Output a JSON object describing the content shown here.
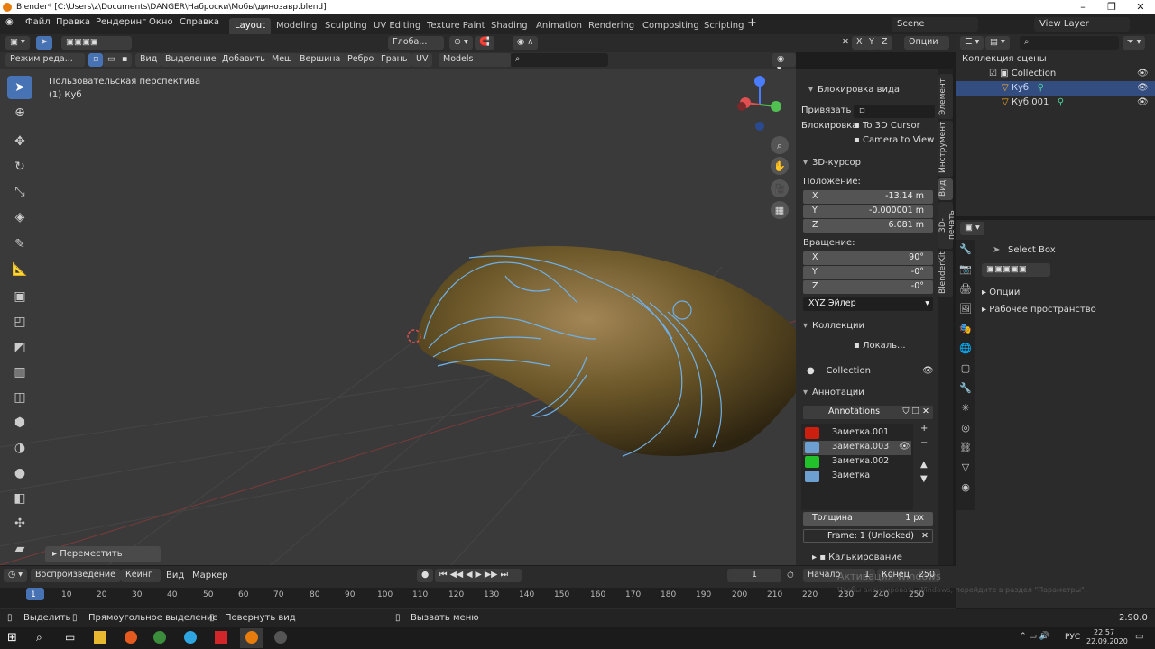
{
  "window": {
    "title": "Blender* [C:\\Users\\z\\Documents\\DANGER\\Наброски\\Мобы\\динозавр.blend]"
  },
  "menu": [
    "Файл",
    "Правка",
    "Рендеринг",
    "Окно",
    "Справка"
  ],
  "workspaces": [
    "Layout",
    "Modeling",
    "Sculpting",
    "UV Editing",
    "Texture Paint",
    "Shading",
    "Animation",
    "Rendering",
    "Compositing",
    "Scripting"
  ],
  "active_workspace": "Layout",
  "scene": "Scene",
  "view_layer": "View Layer",
  "header": {
    "transform": "Глоба...",
    "axes": [
      "X",
      "Y",
      "Z"
    ],
    "options": "Опции"
  },
  "viewport_header": {
    "mode": "Режим реда...",
    "menus": [
      "Вид",
      "Выделение",
      "Добавить",
      "Меш",
      "Вершина",
      "Ребро",
      "Грань",
      "UV"
    ],
    "models": "Models"
  },
  "viewport": {
    "perspective": "Пользовательская перспектива",
    "object": "(1) Куб",
    "operator": "Переместить"
  },
  "npanel": {
    "view_lock": "Блокировка вида",
    "bind_label": "Привязать ...",
    "lock_label": "Блокировка",
    "to_3d_cursor": "To 3D Cursor",
    "camera_to_view": "Camera to View",
    "cursor_title": "3D-курсор",
    "location": "Положение:",
    "loc": [
      {
        "k": "X",
        "v": "-13.14 m"
      },
      {
        "k": "Y",
        "v": "-0.000001 m"
      },
      {
        "k": "Z",
        "v": "6.081 m"
      }
    ],
    "rotation": "Вращение:",
    "rot": [
      {
        "k": "X",
        "v": "90°"
      },
      {
        "k": "Y",
        "v": "-0°"
      },
      {
        "k": "Z",
        "v": "-0°"
      }
    ],
    "rot_mode": "XYZ Эйлер",
    "collections_title": "Коллекции",
    "local": "Локаль...",
    "collection": "Collection",
    "annotations_title": "Аннотации",
    "annotations_name": "Annotations",
    "layers": [
      {
        "name": "Заметка.001",
        "color": "#cc1f0f"
      },
      {
        "name": "Заметка.003",
        "color": "#6da0d0"
      },
      {
        "name": "Заметка.002",
        "color": "#22c02a"
      },
      {
        "name": "Заметка",
        "color": "#6da0d0"
      }
    ],
    "thickness_label": "Толщина",
    "thickness": "1 px",
    "frame": "Frame: 1 (Unlocked)",
    "onion": "Калькирование"
  },
  "sidetabs": [
    "Элемент",
    "Инструмент",
    "Вид",
    "3D-печать",
    "BlenderKit"
  ],
  "outliner": {
    "title": "Коллекция сцены",
    "items": [
      "Collection",
      "Куб",
      "Куб.001"
    ]
  },
  "properties": {
    "tool": "Select Box",
    "sections": [
      "Опции",
      "Рабочее пространство"
    ]
  },
  "timeline": {
    "playback": "Воспроизведение",
    "keying": "Кеинг",
    "view": "Вид",
    "marker": "Маркер",
    "current": "1",
    "start_label": "Начало",
    "start": "1",
    "end_label": "Конец",
    "end": "250",
    "ticks": [
      "1",
      "10",
      "20",
      "30",
      "40",
      "50",
      "60",
      "70",
      "80",
      "90",
      "100",
      "110",
      "120",
      "130",
      "140",
      "150",
      "160",
      "170",
      "180",
      "190",
      "200",
      "210",
      "220",
      "230",
      "240",
      "250"
    ]
  },
  "status": {
    "select": "Выделить",
    "box": "Прямоугольное выделение",
    "rotate": "Повернуть вид",
    "menu": "Вызвать меню",
    "version": "2.90.0"
  },
  "activation": {
    "title": "Активация Windows",
    "text": "Чтобы активировать Windows, перейдите в раздел \"Параметры\"."
  },
  "taskbar": {
    "lang": "РУС",
    "time": "22:57",
    "date": "22.09.2020"
  }
}
